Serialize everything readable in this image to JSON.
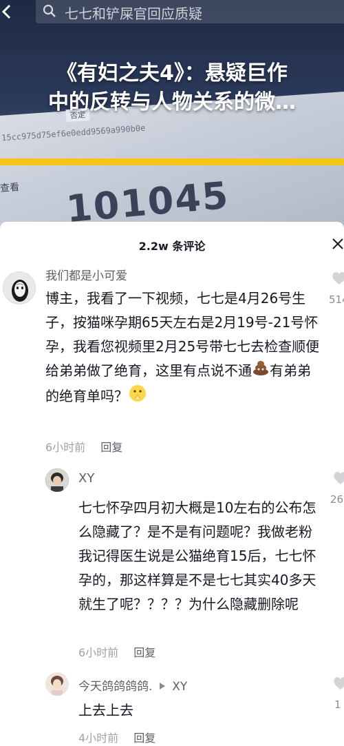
{
  "search": {
    "query": "七七和铲屎官回应质疑"
  },
  "video": {
    "title_line1": "《有妇之夫4》：悬疑巨作",
    "title_line2": "中的反转与人物关系的微…",
    "bg_hash": "15cc975d75ef6e0edd9569a990b0e",
    "bg_tag": "否定",
    "bg_word": "查看",
    "bg_number": "101045"
  },
  "comments_header": {
    "count_label": "2.2w 条评论"
  },
  "comments": [
    {
      "user": "我们都是小可爱",
      "text": "博主，我看了一下视频，七七是4月26号生子，按猫咪孕期65天左右是2月19号-21号怀孕，我看您视频里2月25号带七七去检查顺便给弟弟做了绝育，这里有点说不通",
      "text_tail": "有弟弟的绝育单吗？",
      "time": "6小时前",
      "reply_label": "回复",
      "likes": "514"
    },
    {
      "user": "XY",
      "text": "七七怀孕四月初大概是10左右的公布怎么隐藏了？是不是有问题呢？我做老粉我记得医生说是公猫绝育15后，七七怀孕的，那这样算是不是七七其实40多天就生了呢？？？？为什么隐藏删除呢",
      "time": "6小时前",
      "reply_label": "回复",
      "likes": "26"
    },
    {
      "user": "今天鸽鸽鸽鸽.",
      "reply_to": "XY",
      "text": "上去上去",
      "time": "4小时前",
      "reply_label": "回复",
      "likes": "1"
    }
  ],
  "colors": {
    "accent_yellow": "#f5c518",
    "text_primary": "#161823",
    "text_secondary": "#a0a2a8"
  }
}
